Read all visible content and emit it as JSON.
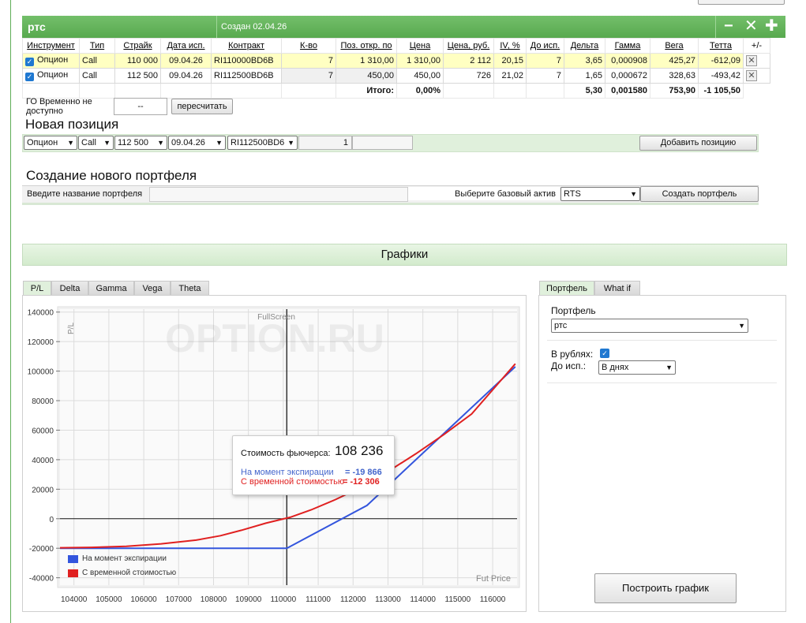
{
  "portfolio": {
    "name": "ртс",
    "created": "Создан 02.04.26",
    "controls": {
      "minus": "−",
      "close": "✕",
      "add": "✚"
    }
  },
  "table": {
    "headers": [
      "Инструмент",
      "Тип",
      "Страйк",
      "Дата исп.",
      "Контракт",
      "К-во",
      "Поз. откр. по",
      "Цена",
      "Цена, руб.",
      "IV, %",
      "До исп.",
      "Дельта",
      "Гамма",
      "Вега",
      "Тетта",
      "+/-"
    ],
    "rows": [
      {
        "instrument": "Опцион",
        "type": "Call",
        "strike": "110 000",
        "date": "09.04.26",
        "contract": "RI110000BD6B",
        "qty": "7",
        "open_price": "1 310,00",
        "price": "1 310,00",
        "price_rub": "2 112",
        "iv": "20,15",
        "days": "7",
        "delta": "3,65",
        "gamma": "0,000908",
        "vega": "425,27",
        "theta": "-612,09"
      },
      {
        "instrument": "Опцион",
        "type": "Call",
        "strike": "112 500",
        "date": "09.04.26",
        "contract": "RI112500BD6B",
        "qty": "7",
        "open_price": "450,00",
        "price": "450,00",
        "price_rub": "726",
        "iv": "21,02",
        "days": "7",
        "delta": "1,65",
        "gamma": "0,000672",
        "vega": "328,63",
        "theta": "-493,42"
      }
    ],
    "totals": {
      "label": "Итого:",
      "price": "0,00%",
      "delta": "5,30",
      "gamma": "0,001580",
      "vega": "753,90",
      "theta": "-1 105,50"
    }
  },
  "go": {
    "label": "ГО Временно не доступно",
    "value": "--",
    "recalc": "пересчитать"
  },
  "new_position": {
    "title": "Новая позиция",
    "instrument": "Опцион",
    "type": "Call",
    "strike": "112 500",
    "date": "09.04.26",
    "contract": "RI112500BD6",
    "qty": "1",
    "add": "Добавить позицию"
  },
  "create_portfolio": {
    "title": "Создание нового портфеля",
    "name_label": "Введите название портфеля",
    "asset_label": "Выберите базовый актив",
    "asset": "RTS",
    "button": "Создать портфель"
  },
  "charts_title": "Графики",
  "chart_tabs": [
    "P/L",
    "Delta",
    "Gamma",
    "Vega",
    "Theta"
  ],
  "chart_fullscreen": "FullScreen",
  "watermark": "OPTION.RU",
  "tooltip": {
    "price_label": "Стоимость фьючерса:",
    "price": "108 236",
    "exp_label": "На момент экспирации",
    "exp_value": "= -19 866",
    "time_label": "С временной стоимостью",
    "time_value": "= -12 306"
  },
  "right_tabs": [
    "Портфель",
    "What if"
  ],
  "right_panel": {
    "portfolio_label": "Портфель",
    "portfolio": "ртс",
    "rub_label": "В рублях:",
    "days_label": "До исп.:",
    "days_value": "В днях",
    "build": "Построить график"
  },
  "chart_data": {
    "type": "line",
    "ylabel": "P/L",
    "xlabel": "Fut Price",
    "xlim": [
      103600,
      116700
    ],
    "ylim": [
      -45000,
      142000
    ],
    "xticks": [
      104000,
      105000,
      106000,
      107000,
      108000,
      109000,
      110000,
      111000,
      112000,
      113000,
      114000,
      115000,
      116000
    ],
    "yticks": [
      -40000,
      -20000,
      0,
      20000,
      40000,
      60000,
      80000,
      100000,
      120000,
      140000
    ],
    "cursor_x": 110100,
    "series": [
      {
        "name": "На момент экспирации",
        "color": "#3355dd",
        "x": [
          103600,
          110100,
          112400,
          116650
        ],
        "y": [
          -20000,
          -20000,
          9000,
          103000
        ]
      },
      {
        "name": "С временной стоимостью",
        "color": "#e02020",
        "x": [
          103600,
          104500,
          105500,
          106500,
          107500,
          108200,
          108800,
          109500,
          110200,
          110800,
          111500,
          112200,
          113000,
          113800,
          114600,
          115400,
          116650
        ],
        "y": [
          -19700,
          -19400,
          -18700,
          -17000,
          -14500,
          -11500,
          -7800,
          -3000,
          1000,
          6000,
          13000,
          21000,
          32000,
          44000,
          57000,
          71000,
          105000
        ]
      }
    ]
  }
}
